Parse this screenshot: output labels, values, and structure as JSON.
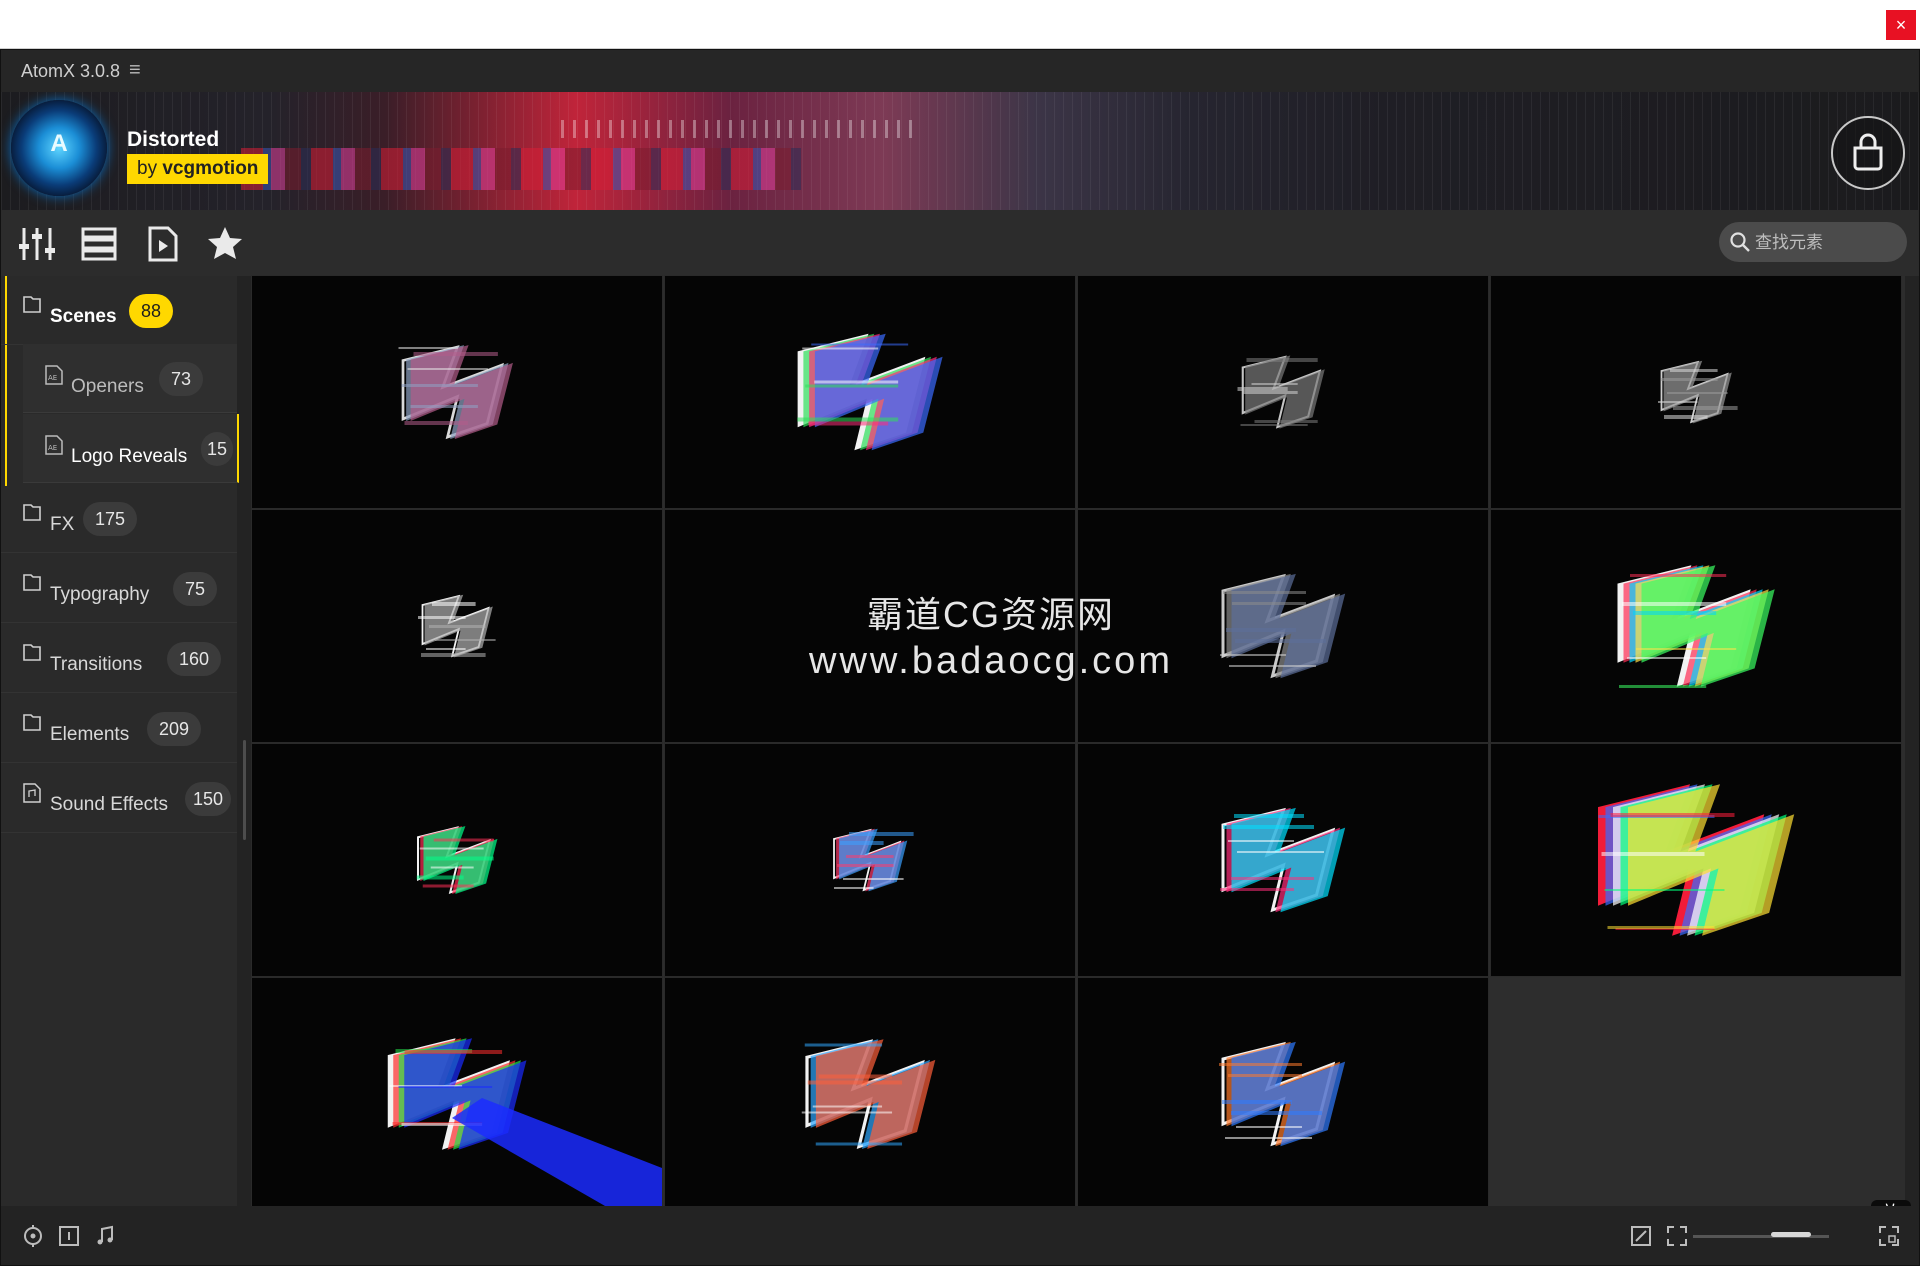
{
  "window": {
    "close_label": "×"
  },
  "app": {
    "name": "AtomX 3.0.8",
    "menu_icon": "hamburger-icon"
  },
  "pack": {
    "title": "Distorted",
    "author_prefix": "by",
    "author": "vcgmotion"
  },
  "toolbar": {
    "tools": [
      "sliders-icon",
      "list-view-icon",
      "preview-icon",
      "favorites-star-icon"
    ],
    "search_placeholder": "查找元素"
  },
  "sidebar": {
    "scenes": {
      "label": "Scenes",
      "count": "88"
    },
    "sub_items": [
      {
        "label": "Openers",
        "count": "73"
      },
      {
        "label": "Logo Reveals",
        "count": "15"
      }
    ],
    "categories": [
      {
        "label": "FX",
        "count": "175"
      },
      {
        "label": "Typography",
        "count": "75"
      },
      {
        "label": "Transitions",
        "count": "160"
      },
      {
        "label": "Elements",
        "count": "209"
      },
      {
        "label": "Sound Effects",
        "count": "150"
      }
    ]
  },
  "thumbnails": 15,
  "watermark": {
    "line1": "霸道CG资源网",
    "line2": "www.badaocg.com"
  },
  "zoom_tag": {
    "line1": "放",
    "line2": "大"
  },
  "colors": {
    "accent": "#ffd800",
    "close": "#e81123",
    "panel": "#2a2a2a"
  }
}
